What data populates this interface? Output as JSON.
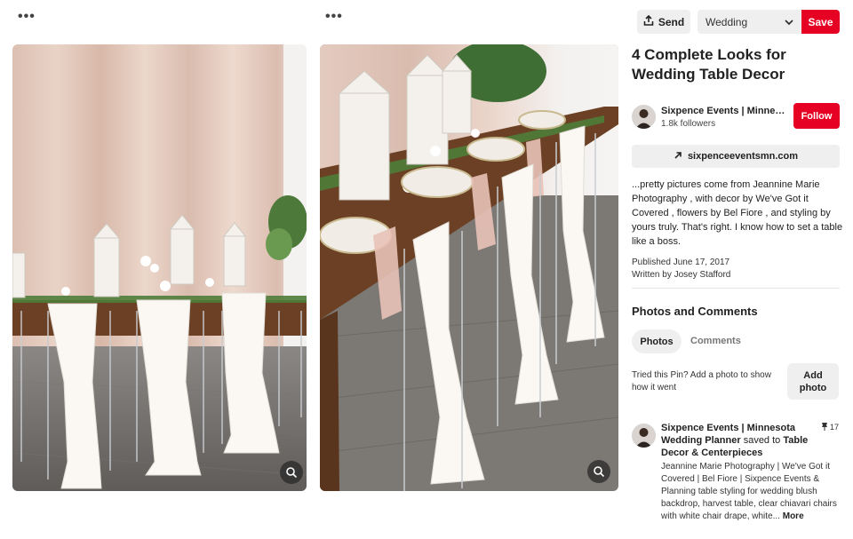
{
  "left_pin": {
    "menu_icon": "more-dots-icon",
    "lens_icon": "visual-search-icon"
  },
  "right_pin": {
    "menu_icon": "more-dots-icon",
    "lens_icon": "visual-search-icon"
  },
  "toolbar": {
    "send_label": "Send",
    "send_icon": "share-upload-icon",
    "board_selected": "Wedding",
    "save_label": "Save"
  },
  "pin": {
    "title": "4 Complete Looks for Wedding Table Decor",
    "creator_name": "Sixpence Events | Minnesota Wedding Planner",
    "followers": "1.8k followers",
    "follow_label": "Follow",
    "website": "sixpenceeventsmn.com",
    "description": "...pretty pictures come from Jeannine Marie Photography , with decor by We've Got it Covered , flowers by Bel Fiore , and styling by yours truly. That's right. I know how to set a table like a boss.",
    "published": "Published June 17, 2017",
    "written_by": "Written by Josey Stafford"
  },
  "photos_comments": {
    "heading": "Photos and Comments",
    "tabs": [
      {
        "label": "Photos"
      },
      {
        "label": "Comments"
      }
    ],
    "prompt": "Tried this Pin? Add a photo to show how it went",
    "add_photo_label": "Add photo"
  },
  "activity": {
    "user": "Sixpence Events | Minnesota Wedding Planner",
    "action": " saved to ",
    "board": "Table Decor & Centerpieces",
    "pin_count": "17",
    "text": "Jeannine Marie Photography | We've Got it Covered | Bel Fiore | Sixpence Events & Planning table styling for wedding blush backdrop, harvest table, clear chiavari chairs with white chair drape, white...",
    "more_label": "More"
  },
  "colors": {
    "accent": "#e60023",
    "button_bg": "#efefef",
    "curtain": "#e3c8bb",
    "wood": "#6b4024"
  }
}
